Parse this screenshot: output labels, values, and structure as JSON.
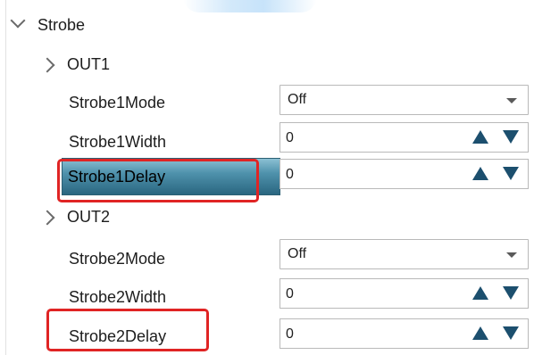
{
  "tree": {
    "root": {
      "label": "Strobe",
      "expanded": true,
      "icon": "chevron-down-icon"
    },
    "groups": [
      {
        "label": "OUT1",
        "icon": "chevron-right-icon",
        "properties": [
          {
            "name": "Strobe1Mode",
            "type": "select",
            "value": "Off"
          },
          {
            "name": "Strobe1Width",
            "type": "spin",
            "value": "0"
          },
          {
            "name": "Strobe1Delay",
            "type": "spin",
            "value": "0",
            "selected": true,
            "highlighted": true
          }
        ]
      },
      {
        "label": "OUT2",
        "icon": "chevron-right-icon",
        "properties": [
          {
            "name": "Strobe2Mode",
            "type": "select",
            "value": "Off"
          },
          {
            "name": "Strobe2Width",
            "type": "spin",
            "value": "0"
          },
          {
            "name": "Strobe2Delay",
            "type": "spin",
            "value": "0",
            "highlighted": true
          }
        ]
      }
    ]
  },
  "colors": {
    "selection_gradient_top": "#8cc0d3",
    "selection_gradient_bottom": "#2a6680",
    "spin_arrow": "#1c4f6e",
    "highlight_border": "#e02424"
  }
}
